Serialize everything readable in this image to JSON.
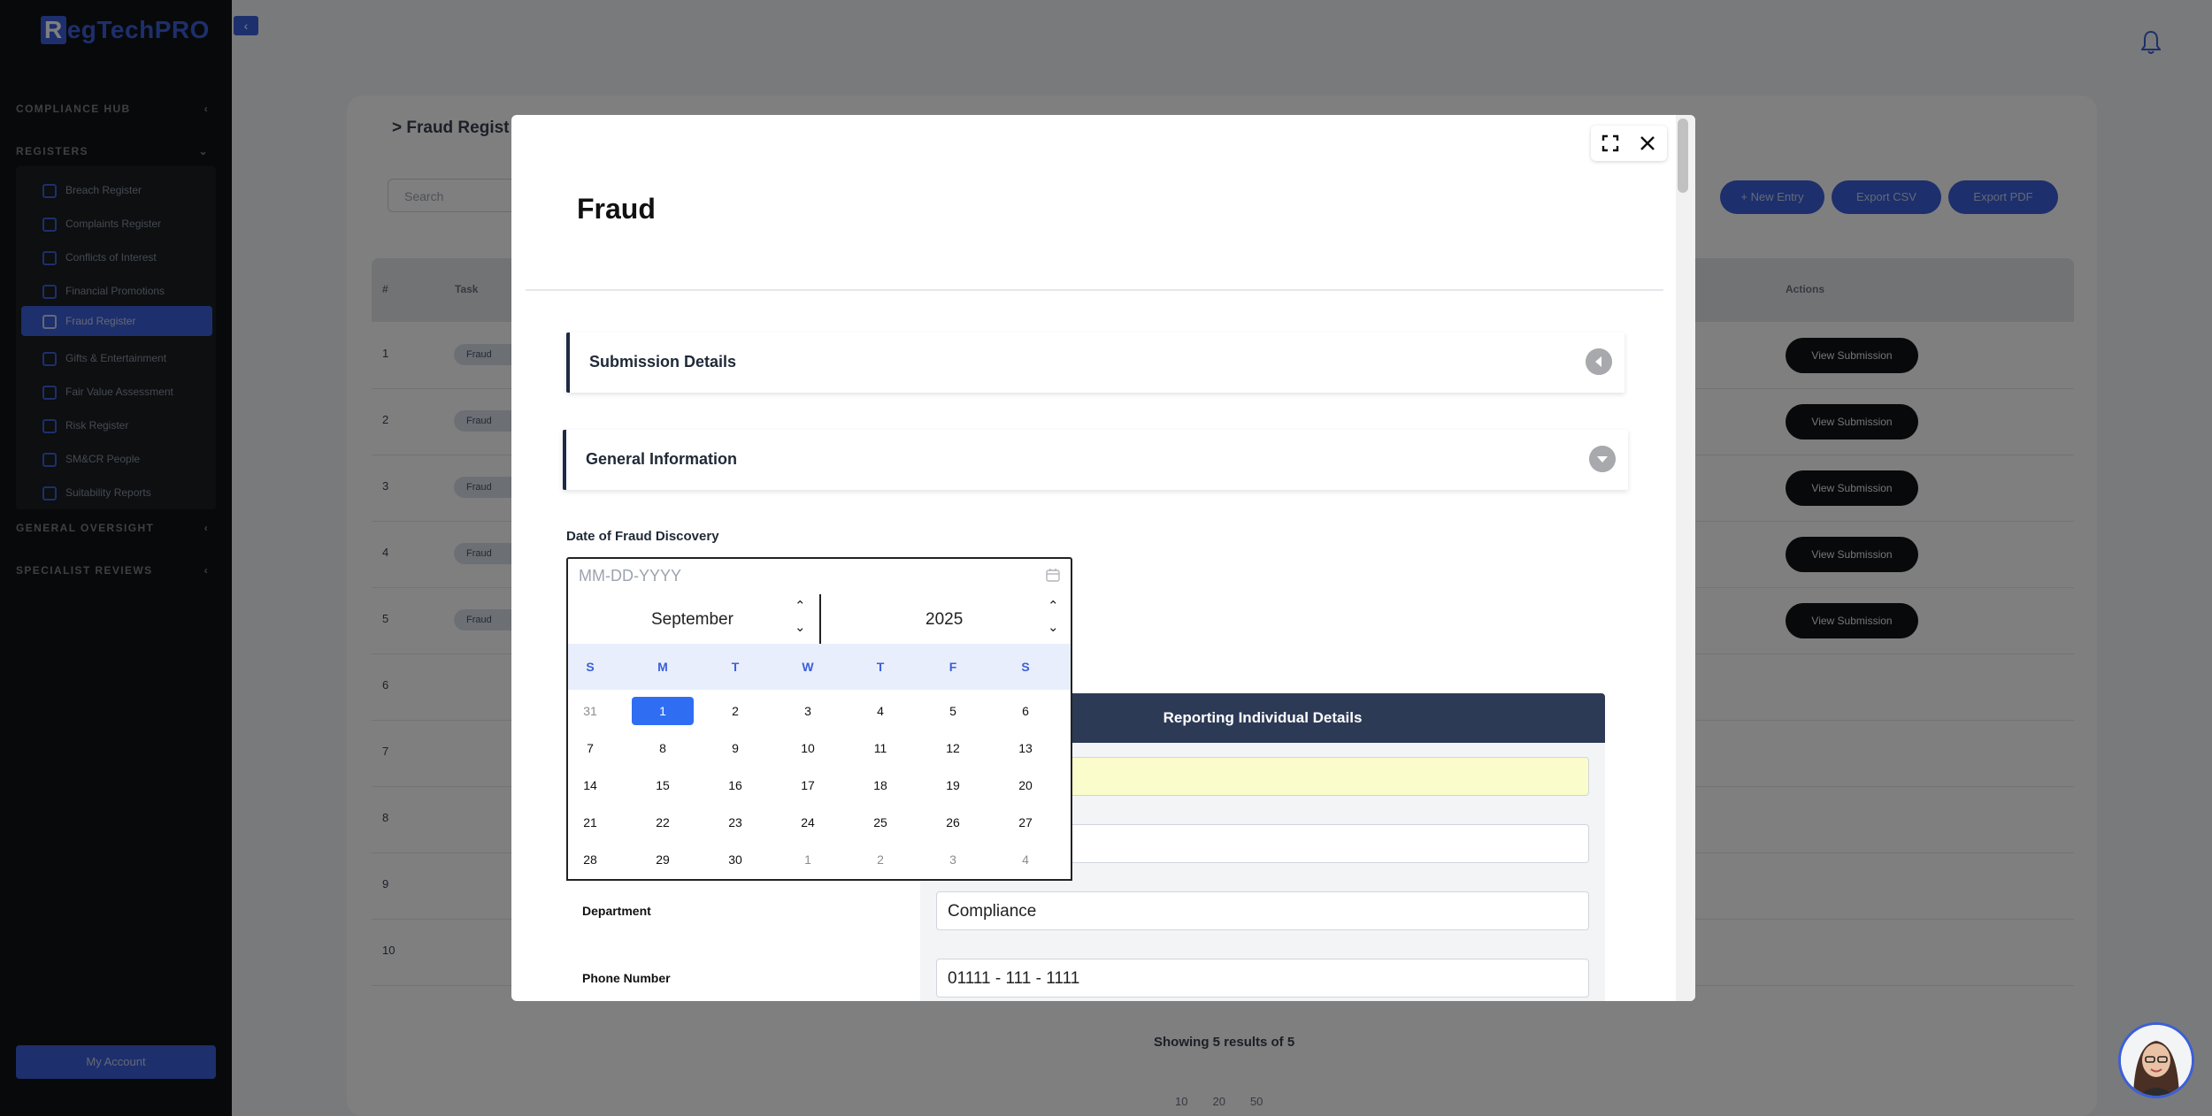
{
  "brand": {
    "logo_first": "R",
    "logo_rest": "egTech",
    "logo_accent": "PRO",
    "color": "#3b5fd9"
  },
  "sidebar": {
    "sections": {
      "compliance_hub": "COMPLIANCE HUB",
      "registers": "REGISTERS",
      "general_oversight": "GENERAL OVERSIGHT",
      "specialist_reviews": "SPECIALIST REVIEWS"
    },
    "items": [
      {
        "label": "Breach Register",
        "icon": "shield-icon"
      },
      {
        "label": "Complaints Register",
        "icon": "clipboard-icon"
      },
      {
        "label": "Conflicts of Interest",
        "icon": "users-icon"
      },
      {
        "label": "Financial Promotions",
        "icon": "megaphone-icon"
      },
      {
        "label": "Fraud Register",
        "icon": "document-icon",
        "active": true
      },
      {
        "label": "Gifts & Entertainment",
        "icon": "gift-icon"
      },
      {
        "label": "Fair Value Assessment",
        "icon": "scale-icon"
      },
      {
        "label": "Risk Register",
        "icon": "alert-icon"
      },
      {
        "label": "SM&CR People",
        "icon": "person-icon"
      },
      {
        "label": "Suitability Reports",
        "icon": "file-icon"
      }
    ],
    "account_button": "My Account"
  },
  "background_page": {
    "title": "> Fraud Regist",
    "search_placeholder": "Search",
    "buttons": {
      "new_entry": "+ New Entry",
      "export_csv": "Export CSV",
      "export_pdf": "Export PDF"
    },
    "table_headers": {
      "num": "#",
      "task": "Task",
      "actions": "Actions"
    },
    "rows": [
      {
        "num": "1",
        "tag": "Fraud",
        "action": "View Submission"
      },
      {
        "num": "2",
        "tag": "Fraud",
        "action": "View Submission"
      },
      {
        "num": "3",
        "tag": "Fraud",
        "action": "View Submission"
      },
      {
        "num": "4",
        "tag": "Fraud",
        "action": "View Submission"
      },
      {
        "num": "5",
        "tag": "Fraud",
        "action": "View Submission"
      },
      {
        "num": "6"
      },
      {
        "num": "7"
      },
      {
        "num": "8"
      },
      {
        "num": "9"
      },
      {
        "num": "10"
      }
    ],
    "showing": "Showing 5 results of 5",
    "page_sizes": [
      "10",
      "20",
      "50"
    ]
  },
  "modal": {
    "title": "Fraud",
    "sections": {
      "submission_details": "Submission Details",
      "general_information": "General Information"
    },
    "date_field": {
      "label": "Date of Fraud Discovery",
      "placeholder": "MM-DD-YYYY"
    },
    "datepicker": {
      "month": "September",
      "year": "2025",
      "weekdays": [
        "S",
        "M",
        "T",
        "W",
        "T",
        "F",
        "S"
      ],
      "weeks": [
        [
          {
            "d": "31",
            "m": true
          },
          {
            "d": "1",
            "s": true
          },
          {
            "d": "2"
          },
          {
            "d": "3"
          },
          {
            "d": "4"
          },
          {
            "d": "5"
          },
          {
            "d": "6"
          }
        ],
        [
          {
            "d": "7"
          },
          {
            "d": "8"
          },
          {
            "d": "9"
          },
          {
            "d": "10"
          },
          {
            "d": "11"
          },
          {
            "d": "12"
          },
          {
            "d": "13"
          }
        ],
        [
          {
            "d": "14"
          },
          {
            "d": "15"
          },
          {
            "d": "16"
          },
          {
            "d": "17"
          },
          {
            "d": "18"
          },
          {
            "d": "19"
          },
          {
            "d": "20"
          }
        ],
        [
          {
            "d": "21"
          },
          {
            "d": "22"
          },
          {
            "d": "23"
          },
          {
            "d": "24"
          },
          {
            "d": "25"
          },
          {
            "d": "26"
          },
          {
            "d": "27"
          }
        ],
        [
          {
            "d": "28"
          },
          {
            "d": "29"
          },
          {
            "d": "30"
          },
          {
            "d": "1",
            "m": true
          },
          {
            "d": "2",
            "m": true
          },
          {
            "d": "3",
            "m": true
          },
          {
            "d": "4",
            "m": true
          }
        ]
      ],
      "selected_color": "#2f6ef2"
    },
    "reporting": {
      "header": "Reporting Individual Details",
      "fields": [
        {
          "label": "",
          "value": ""
        },
        {
          "label": "",
          "value": ""
        },
        {
          "label": "Department",
          "value": "Compliance"
        },
        {
          "label": "Phone Number",
          "value": "01111 - 111 - 1111"
        }
      ]
    }
  }
}
